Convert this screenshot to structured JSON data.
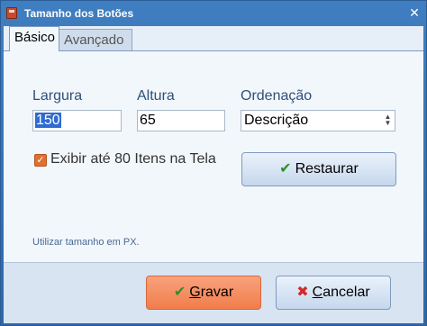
{
  "window": {
    "title": "Tamanho dos Botões",
    "close_label": "✕"
  },
  "tabs": [
    {
      "label": "Básico",
      "active": true
    },
    {
      "label": "Avançado",
      "active": false
    }
  ],
  "fields": {
    "largura": {
      "label": "Largura",
      "value": "150"
    },
    "altura": {
      "label": "Altura",
      "value": "65"
    },
    "ordenacao": {
      "label": "Ordenação",
      "value": "Descrição"
    }
  },
  "checkbox": {
    "label": "Exibir até 80 Itens na Tela",
    "checked": true,
    "check_glyph": "✓"
  },
  "restaurar": {
    "label": "Restaurar",
    "icon": "checkmark-icon",
    "icon_glyph": "✔"
  },
  "hint": "Utilizar tamanho em PX.",
  "footer": {
    "gravar": {
      "label_u": "G",
      "label_rest": "ravar",
      "icon": "checkmark-icon",
      "icon_glyph": "✔"
    },
    "cancelar": {
      "label_u": "C",
      "label_rest": "ancelar",
      "icon": "x-icon",
      "icon_glyph": "✖"
    }
  },
  "colors": {
    "accent": "#2f6bd1",
    "primary_button": "#f17d4c",
    "cancel_icon": "#d12a2a",
    "check_icon": "#2f8f2f"
  }
}
